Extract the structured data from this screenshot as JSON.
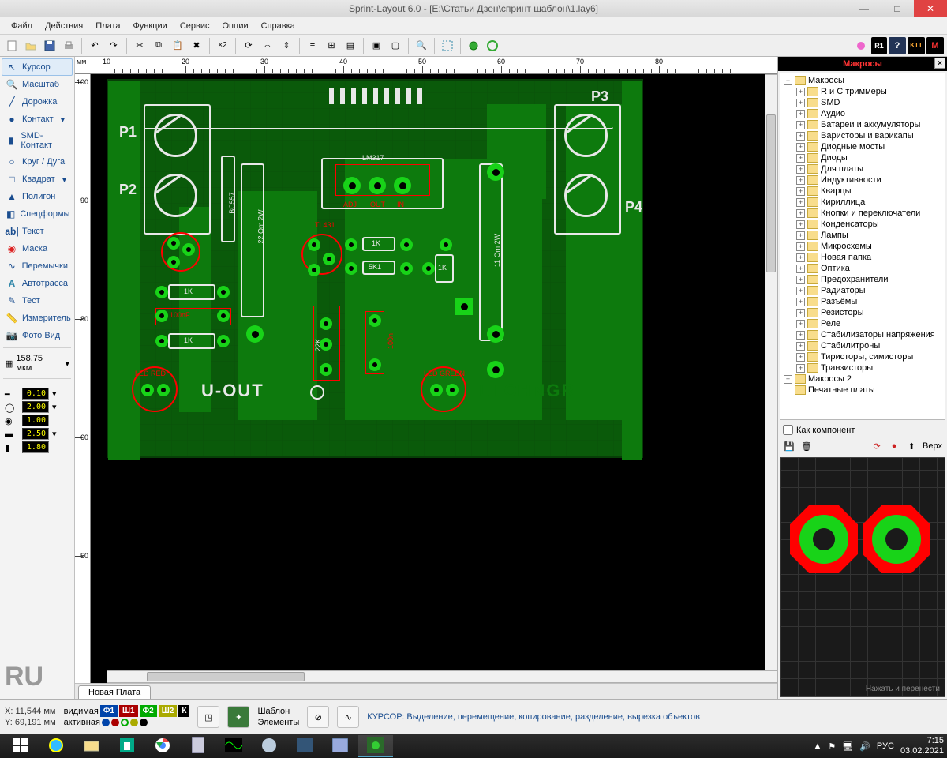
{
  "window": {
    "title": "Sprint-Layout 6.0 - [E:\\Статьи Дзен\\спринт шаблон\\1.lay6]"
  },
  "menu": [
    "Файл",
    "Действия",
    "Плата",
    "Функции",
    "Сервис",
    "Опции",
    "Справка"
  ],
  "tools": [
    {
      "icon": "cursor",
      "label": "Курсор",
      "active": true
    },
    {
      "icon": "zoom",
      "label": "Масштаб"
    },
    {
      "icon": "track",
      "label": "Дорожка"
    },
    {
      "icon": "contact",
      "label": "Контакт",
      "dd": true
    },
    {
      "icon": "smd",
      "label": "SMD-Контакт"
    },
    {
      "icon": "circle",
      "label": "Круг / Дуга"
    },
    {
      "icon": "square",
      "label": "Квадрат",
      "dd": true
    },
    {
      "icon": "poly",
      "label": "Полигон"
    },
    {
      "icon": "spec",
      "label": "Спецформы",
      "dd": true
    },
    {
      "icon": "text",
      "label": "Текст"
    },
    {
      "icon": "mask",
      "label": "Маска"
    },
    {
      "icon": "jumper",
      "label": "Перемычки"
    },
    {
      "icon": "auto",
      "label": "Автотрасса"
    },
    {
      "icon": "test",
      "label": "Тест"
    },
    {
      "icon": "meas",
      "label": "Измеритель"
    },
    {
      "icon": "photo",
      "label": "Фото Вид"
    }
  ],
  "grid": {
    "value": "158,75 мкм"
  },
  "vals": [
    {
      "v": "0.10"
    },
    {
      "v": "2.00"
    },
    {
      "v": "1.00"
    },
    {
      "v": "2.50"
    },
    {
      "v": "1.80"
    }
  ],
  "ruler": {
    "unit": "мм",
    "h": [
      "10",
      "20",
      "30",
      "40",
      "50",
      "60",
      "70",
      "80"
    ],
    "v": [
      "100",
      "90",
      "80",
      "60",
      "50"
    ]
  },
  "pcb_labels": {
    "p1": "P1",
    "p2": "P2",
    "p3": "P3",
    "p4": "P4",
    "uout": "U-OUT",
    "li": "LI  CHNGR",
    "lm": "LM317",
    "adj": "ADJ",
    "out": "OUT",
    "in": "IN",
    "ledr": "LED RED",
    "ledg": "LED GREEN",
    "r1": "1K",
    "r2": "1K",
    "r3": "1K",
    "r4": "1K",
    "r5": "5K1",
    "r6": "22K",
    "c1": "100nF",
    "c2": "100n",
    "bc": "BC557",
    "tl": "TL431",
    "res220": "22 Om 2W",
    "res110": "11 Om 2W"
  },
  "board_tab": "Новая Плата",
  "ru_logo": "RU",
  "macros": {
    "title": "Макросы",
    "root": "Макросы",
    "root2": "Макросы 2",
    "printed": "Печатные платы",
    "folders": [
      "R и C триммеры",
      "SMD",
      "Аудио",
      "Батареи и аккумуляторы",
      "Варисторы и варикапы",
      "Диодные мосты",
      "Диоды",
      "Для платы",
      "Индуктивности",
      "Кварцы",
      "Кириллица",
      "Кнопки и переключатели",
      "Конденсаторы",
      "Лампы",
      "Микросхемы",
      "Новая папка",
      "Оптика",
      "Предохранители",
      "Радиаторы",
      "Разъёмы",
      "Резисторы",
      "Реле",
      "Стабилизаторы напряжения",
      "Стабилитроны",
      "Тиристоры, симисторы",
      "Транзисторы"
    ],
    "as_component": "Как компонент",
    "up": "Верх",
    "hint": "Нажать и перенести"
  },
  "status": {
    "x": "11,544 мм",
    "y": "69,191 мм",
    "vis": "видимая",
    "act": "активная",
    "layers": [
      "Ф1",
      "Ш1",
      "Ф2",
      "Ш2",
      "К"
    ],
    "template": "Шаблон",
    "elements": "Элементы",
    "hint": "КУРСОР: Выделение, перемещение, копирование, разделение, вырезка объектов"
  },
  "taskbar": {
    "lang": "РУС",
    "time": "7:15",
    "date": "03.02.2021"
  }
}
